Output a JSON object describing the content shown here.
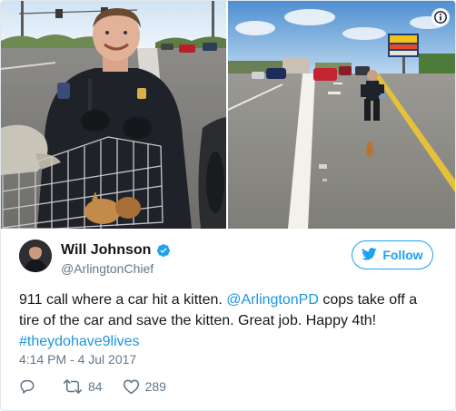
{
  "tweet": {
    "author": {
      "display_name": "Will Johnson",
      "handle": "@ArlingtonChief",
      "verified": true
    },
    "follow_button": {
      "label": "Follow",
      "icon": "twitter-bird-icon"
    },
    "text": {
      "part1": "911 call where a car hit a kitten. ",
      "mention": "@ArlingtonPD",
      "part2": " cops take off a tire of the car and save the kitten. Great job. Happy 4th!",
      "hashtag": "#theydohave9lives"
    },
    "timestamp": "4:14 PM - 4 Jul 2017",
    "actions": {
      "reply": {
        "icon": "reply-icon"
      },
      "retweet": {
        "icon": "retweet-icon",
        "count": "84"
      },
      "like": {
        "icon": "heart-icon",
        "count": "289"
      }
    }
  },
  "media": {
    "photos": [
      {
        "subject": "officer-holding-cat-trap"
      },
      {
        "subject": "officer-on-highway-with-kitten"
      }
    ],
    "info_icon": "info-icon"
  },
  "colors": {
    "accent": "#1da1f2",
    "link": "#1b95e0",
    "muted": "#657786",
    "text": "#14171a"
  }
}
